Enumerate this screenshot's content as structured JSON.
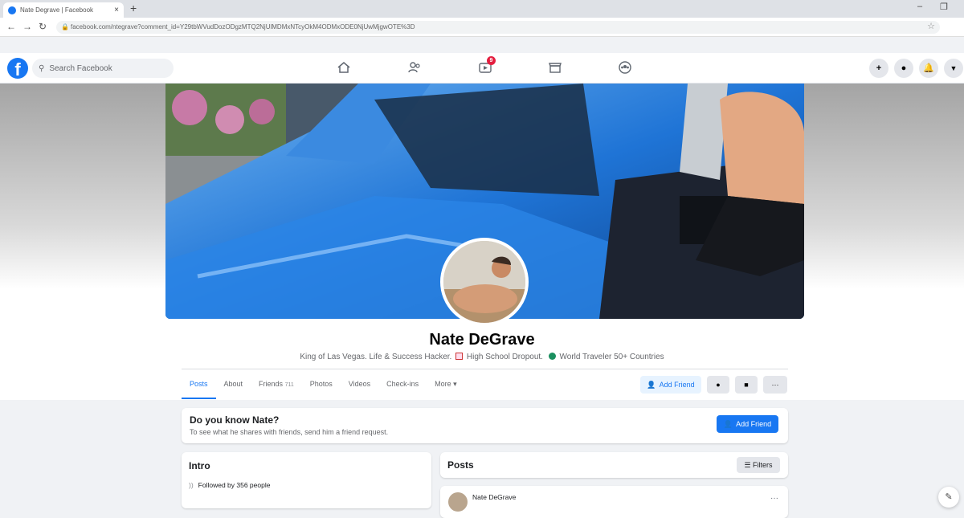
{
  "browser": {
    "tab_title": "Nate Degrave | Facebook",
    "tab_close": "×",
    "new_tab": "+",
    "url": "facebook.com/ntegrave?comment_id=Y29tbWVudDozODgzMTQ2NjUlMDMxNTcyOkM4ODMxODE0NjUwMjgwOTE%3D",
    "minimize": "–",
    "restore": "❐"
  },
  "fb_nav": {
    "logo": "f",
    "search_placeholder": "Search Facebook",
    "notification_count": "9",
    "plus": "+"
  },
  "profile": {
    "name": "Nate DeGrave",
    "bio_part1": "King of Las Vegas. Life & Success Hacker.",
    "bio_part2": "High School Dropout.",
    "bio_part3": "World Traveler 50+ Countries",
    "tabs": [
      {
        "label": "Posts"
      },
      {
        "label": "About"
      },
      {
        "label": "Friends",
        "count": "711"
      },
      {
        "label": "Photos"
      },
      {
        "label": "Videos"
      },
      {
        "label": "Check-ins"
      },
      {
        "label": "More ▾"
      }
    ],
    "add_friend": "Add Friend",
    "more_dots": "···"
  },
  "know": {
    "title": "Do you know Nate?",
    "subtitle": "To see what he shares with friends, send him a friend request.",
    "add_friend": "Add Friend"
  },
  "intro": {
    "title": "Intro",
    "followed_by": "Followed by 356 people"
  },
  "posts": {
    "title": "Posts",
    "filters": "Filters",
    "author": "Nate DeGrave",
    "more": "···"
  },
  "colors": {
    "brand": "#1877f2",
    "badge": "#e41e3f"
  }
}
